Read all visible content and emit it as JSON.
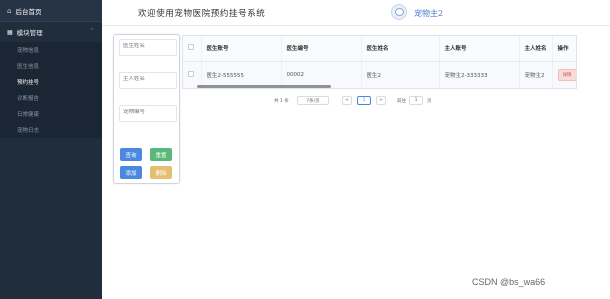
{
  "sidebar": {
    "home_label": "后台首页",
    "home_icon": "home-icon",
    "group_label": "模块管理",
    "group_icon": "grid-icon",
    "items": [
      {
        "label": "宠物信息",
        "active": false
      },
      {
        "label": "医生信息",
        "active": false
      },
      {
        "label": "预约挂号",
        "active": true
      },
      {
        "label": "诊断报告",
        "active": false
      },
      {
        "label": "日常健康",
        "active": false
      },
      {
        "label": "宠物日志",
        "active": false
      }
    ]
  },
  "header": {
    "welcome": "欢迎使用宠物医院预约挂号系统",
    "username": "宠物主2"
  },
  "search": {
    "fields": [
      {
        "placeholder": "医生姓名"
      },
      {
        "placeholder": "主人姓名"
      },
      {
        "placeholder": "宠物编号"
      }
    ],
    "buttons": {
      "query": "查询",
      "reset": "重置",
      "add": "添加",
      "delete": "删除"
    }
  },
  "table": {
    "columns": [
      "",
      "医生账号",
      "医生编号",
      "医生姓名",
      "主人账号",
      "主人姓名",
      "操作"
    ],
    "rows": [
      {
        "doctor_account": "医生2-555555",
        "doctor_id": "00002",
        "doctor_name": "医生2",
        "owner_account": "宠物主2-333333",
        "owner_name": "宠物主2",
        "action": "详情"
      }
    ]
  },
  "pagination": {
    "total": "共 1 条",
    "page_size": "7条/页",
    "prev": "<",
    "current": "1",
    "next": ">",
    "goto_label": "前往",
    "goto_value": "1",
    "page_suffix": "页"
  },
  "colors": {
    "sidebar_bg": "#1f2d3d",
    "primary": "#4b89e0",
    "success": "#5cb87a",
    "warning": "#e4c06e",
    "danger": "#d44444"
  },
  "watermark": "CSDN @bs_wa66"
}
